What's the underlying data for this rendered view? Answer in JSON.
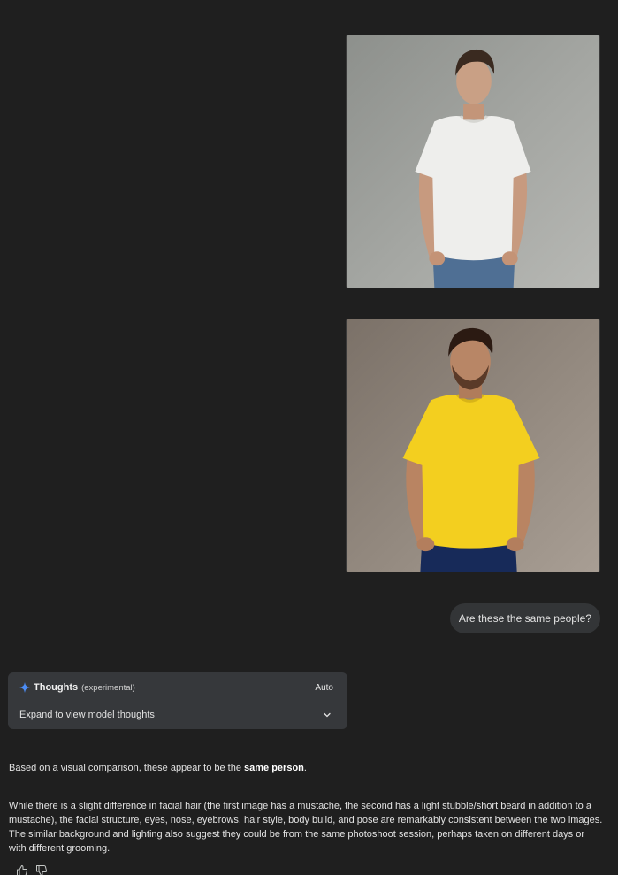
{
  "conversation": {
    "user_images": [
      {
        "name": "man-white-tshirt-photo",
        "shirt_color": "#eeeeec"
      },
      {
        "name": "man-yellow-tshirt-photo",
        "shirt_color": "#f3cf1f"
      }
    ],
    "user_message": "Are these the same people?"
  },
  "thoughts": {
    "title": "Thoughts",
    "tag": "(experimental)",
    "mode": "Auto",
    "expand_label": "Expand to view model thoughts",
    "icon": "spark-icon",
    "accent_color": "#4c8df6"
  },
  "response": {
    "p1_before": "Based on a visual comparison, these appear to be the ",
    "p1_bold": "same person",
    "p1_after": ".",
    "p2": "While there is a slight difference in facial hair (the first image has a mustache, the second has a light stubble/short beard in addition to a mustache), the facial structure, eyes, nose, eyebrows, hair style, body build, and pose are remarkably consistent between the two images. The similar background and lighting also suggest they could be from the same photoshoot session, perhaps taken on different days or with different grooming."
  },
  "feedback": {
    "icons": [
      "thumbs-up-icon",
      "thumbs-down-icon"
    ]
  },
  "colors": {
    "background": "#1f1f1f",
    "card": "#36383b",
    "bubble": "#333537",
    "text": "#e3e3e3"
  }
}
